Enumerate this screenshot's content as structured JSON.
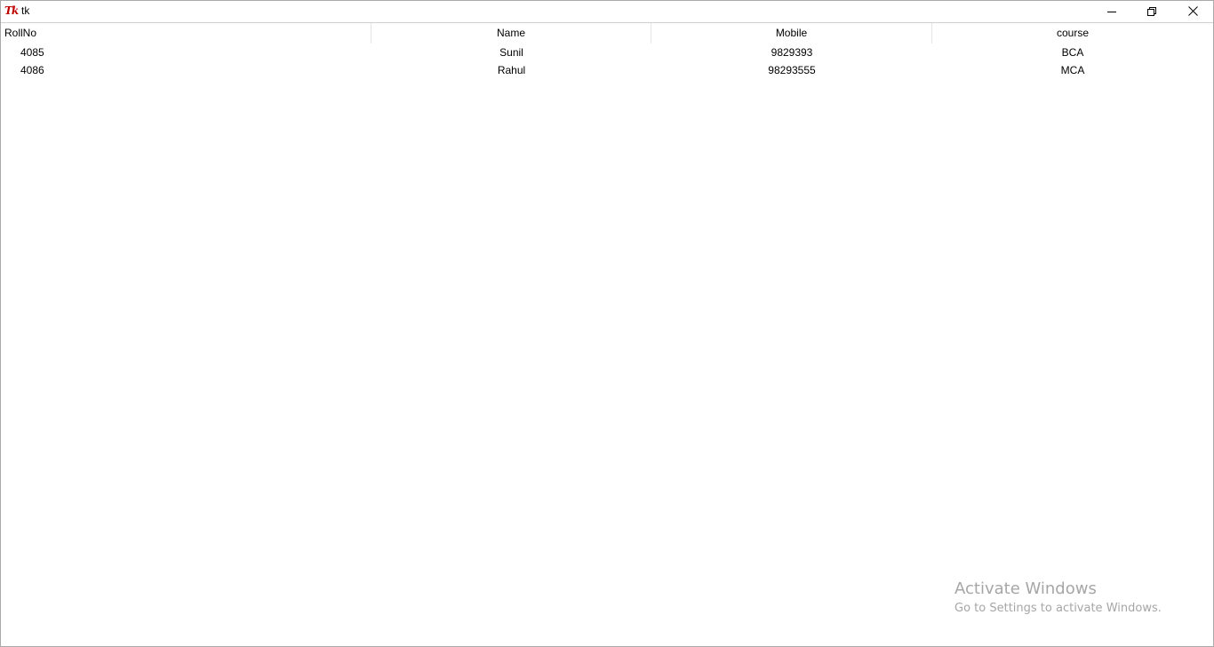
{
  "window": {
    "title": "tk",
    "icon_text": "Tk",
    "icons": {
      "app": "tk-feather-icon",
      "minimize": "minimize-icon",
      "restore": "restore-icon",
      "close": "close-icon"
    }
  },
  "table": {
    "columns": [
      "RollNo",
      "Name",
      "Mobile",
      "course"
    ],
    "rows": [
      [
        "4085",
        "Sunil",
        "9829393",
        "BCA"
      ],
      [
        "4086",
        "Rahul",
        "98293555",
        "MCA"
      ]
    ]
  },
  "watermark": {
    "title": "Activate Windows",
    "subtitle": "Go to Settings to activate Windows."
  }
}
